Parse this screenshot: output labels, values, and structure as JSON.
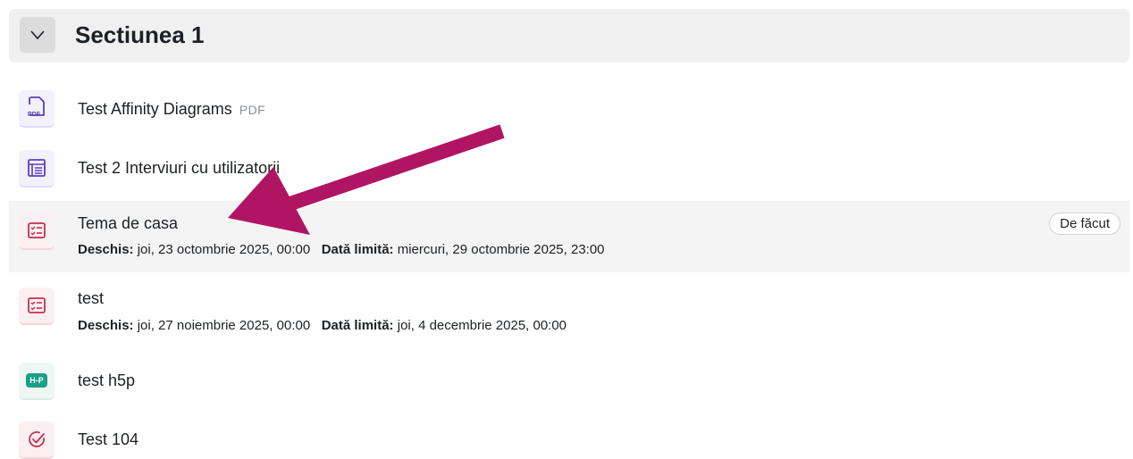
{
  "section": {
    "title": "Sectiunea 1",
    "collapse_icon": "chevron-down-icon"
  },
  "activities": [
    {
      "name": "Test Affinity Diagrams",
      "type": "PDF",
      "icon": "pdf-file-icon"
    },
    {
      "name": "Test 2 Interviuri cu utilizatorii",
      "icon": "page-icon"
    },
    {
      "name": "Tema de casa",
      "icon": "assignment-icon",
      "opened_label": "Deschis:",
      "opened_value": "joi, 23 octombrie 2025, 00:00",
      "due_label": "Dată limită:",
      "due_value": "miercuri, 29 octombrie 2025, 23:00",
      "status": "De făcut"
    },
    {
      "name": "test",
      "icon": "assignment-icon",
      "opened_label": "Deschis:",
      "opened_value": "joi, 27 noiembrie 2025, 00:00",
      "due_label": "Dată limită:",
      "due_value": "joi, 4 decembrie 2025, 00:00"
    },
    {
      "name": "test h5p",
      "icon": "h5p-icon",
      "icon_text": "H-P"
    },
    {
      "name": "Test 104",
      "icon": "quiz-check-icon"
    }
  ],
  "colors": {
    "arrow": "#b01563",
    "assignment_icon": "#c4314b",
    "page_icon": "#5b3fbd",
    "h5p_badge": "#17a085"
  }
}
